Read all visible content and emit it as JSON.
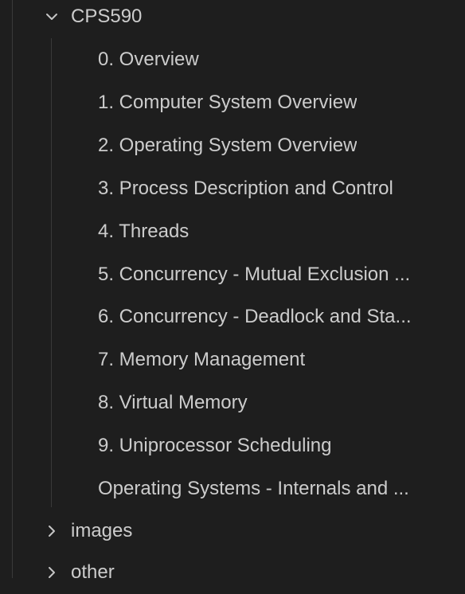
{
  "explorer": {
    "root_folder": {
      "label": "CPS590",
      "expanded": true,
      "icon": "chevron-down-icon"
    },
    "files": [
      {
        "label": "0. Overview"
      },
      {
        "label": "1. Computer System Overview"
      },
      {
        "label": "2. Operating System Overview"
      },
      {
        "label": "3. Process Description and Control"
      },
      {
        "label": "4. Threads"
      },
      {
        "label": "5. Concurrency - Mutual Exclusion ..."
      },
      {
        "label": "6. Concurrency - Deadlock and Sta..."
      },
      {
        "label": "7. Memory Management"
      },
      {
        "label": "8. Virtual Memory"
      },
      {
        "label": "9. Uniprocessor Scheduling"
      },
      {
        "label": "Operating Systems - Internals and ..."
      }
    ],
    "sibling_folders": [
      {
        "label": "images",
        "expanded": false,
        "icon": "chevron-right-icon"
      },
      {
        "label": "other",
        "expanded": false,
        "icon": "chevron-right-icon"
      }
    ]
  },
  "colors": {
    "background": "#1e1e1e",
    "text": "#cccccc",
    "guide": "#3a3a3a",
    "chevron": "#c5c5c5"
  }
}
